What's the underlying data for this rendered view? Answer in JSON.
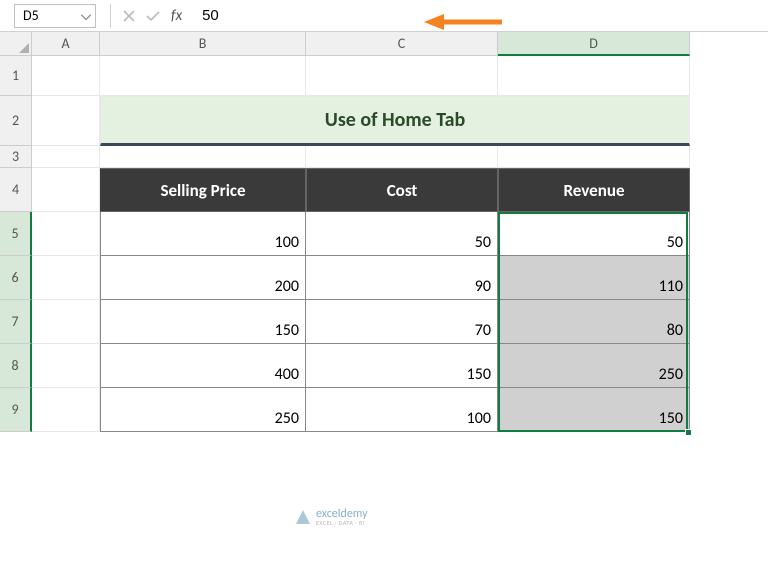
{
  "nameBox": {
    "value": "D5"
  },
  "formulaBar": {
    "value": "50"
  },
  "columns": [
    {
      "label": "A",
      "active": false
    },
    {
      "label": "B",
      "active": false
    },
    {
      "label": "C",
      "active": false
    },
    {
      "label": "D",
      "active": true
    }
  ],
  "rows": [
    {
      "label": "1",
      "active": false
    },
    {
      "label": "2",
      "active": false
    },
    {
      "label": "3",
      "active": false
    },
    {
      "label": "4",
      "active": false
    },
    {
      "label": "5",
      "active": true
    },
    {
      "label": "6",
      "active": true
    },
    {
      "label": "7",
      "active": true
    },
    {
      "label": "8",
      "active": true
    },
    {
      "label": "9",
      "active": true
    }
  ],
  "title": "Use of Home Tab",
  "headers": {
    "b": "Selling Price",
    "c": "Cost",
    "d": "Revenue"
  },
  "data": [
    {
      "b": "100",
      "c": "50",
      "d": "50"
    },
    {
      "b": "200",
      "c": "90",
      "d": "110"
    },
    {
      "b": "150",
      "c": "70",
      "d": "80"
    },
    {
      "b": "400",
      "c": "150",
      "d": "250"
    },
    {
      "b": "250",
      "c": "100",
      "d": "150"
    }
  ],
  "watermark": {
    "brand": "exceldemy",
    "tagline": "EXCEL · DATA · BI"
  },
  "colors": {
    "accent": "#107c41",
    "arrow": "#f58220",
    "header": "#3a3a3a",
    "banner": "#e4f0e0"
  }
}
